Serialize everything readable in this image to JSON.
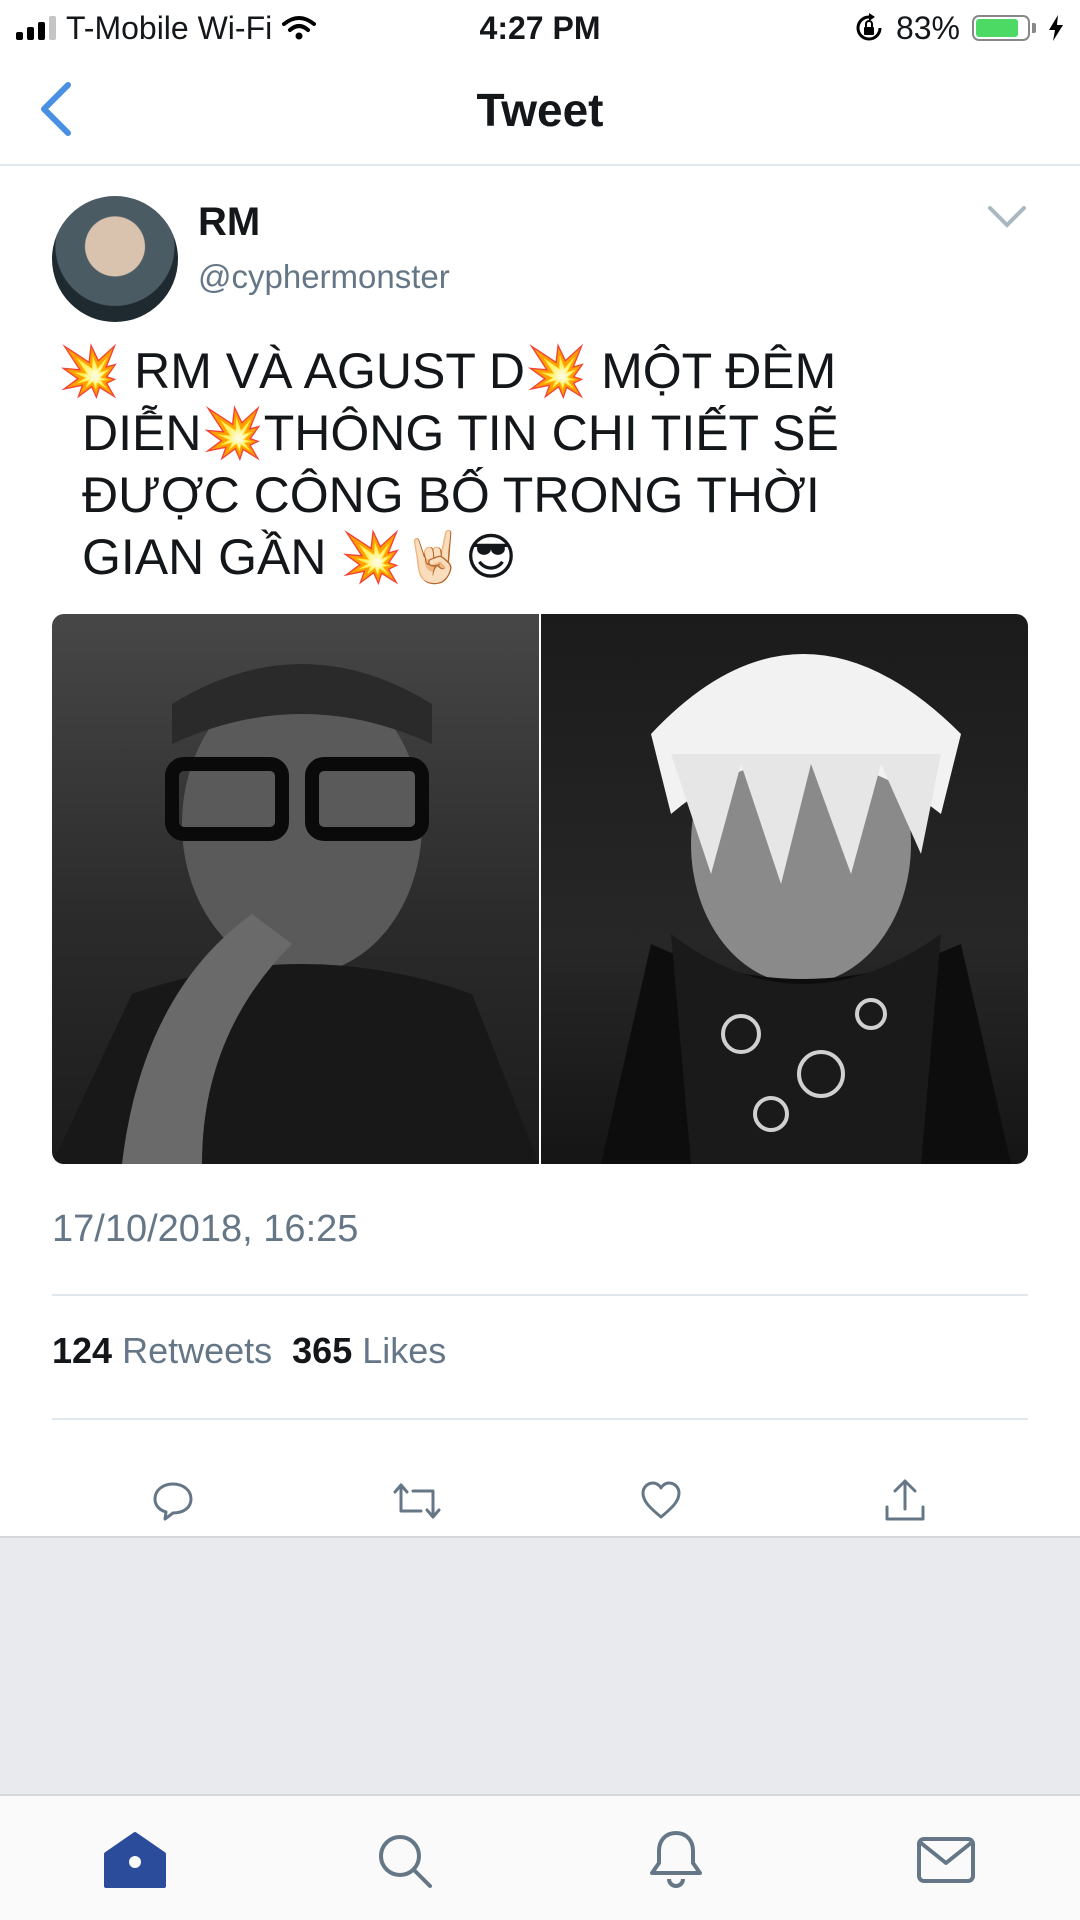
{
  "status_bar": {
    "carrier": "T-Mobile Wi-Fi",
    "time": "4:27 PM",
    "battery_percent": "83%",
    "battery_level": 0.83,
    "icons": [
      "signal-icon",
      "wifi-icon",
      "rotation-lock-icon",
      "battery-icon",
      "charging-bolt-icon"
    ]
  },
  "nav": {
    "title": "Tweet",
    "back_icon": "back-chevron-icon"
  },
  "tweet": {
    "author_name": "RM",
    "author_handle": "@cyphermonster",
    "text_lines": [
      "💥 RM VÀ AGUST D💥 MỘT ĐÊM",
      "DIỄN💥THÔNG TIN CHI TIẾT SẼ",
      "ĐƯỢC CÔNG BỐ TRONG THỜI",
      "GIAN GẦN 💥🤘🏻😎"
    ],
    "timestamp": "17/10/2018, 16:25",
    "retweets_count": "124",
    "retweets_label": "Retweets",
    "likes_count": "365",
    "likes_label": "Likes"
  },
  "actions": [
    "reply-icon",
    "retweet-icon",
    "like-icon",
    "share-icon"
  ],
  "tab_bar": [
    "home-icon",
    "search-icon",
    "notifications-icon",
    "messages-icon"
  ],
  "colors": {
    "accent": "#4a90e2",
    "secondary_text": "#657786",
    "divider": "#e1e8ed",
    "home_active": "#2b4c9b",
    "battery_green": "#4cd964"
  }
}
